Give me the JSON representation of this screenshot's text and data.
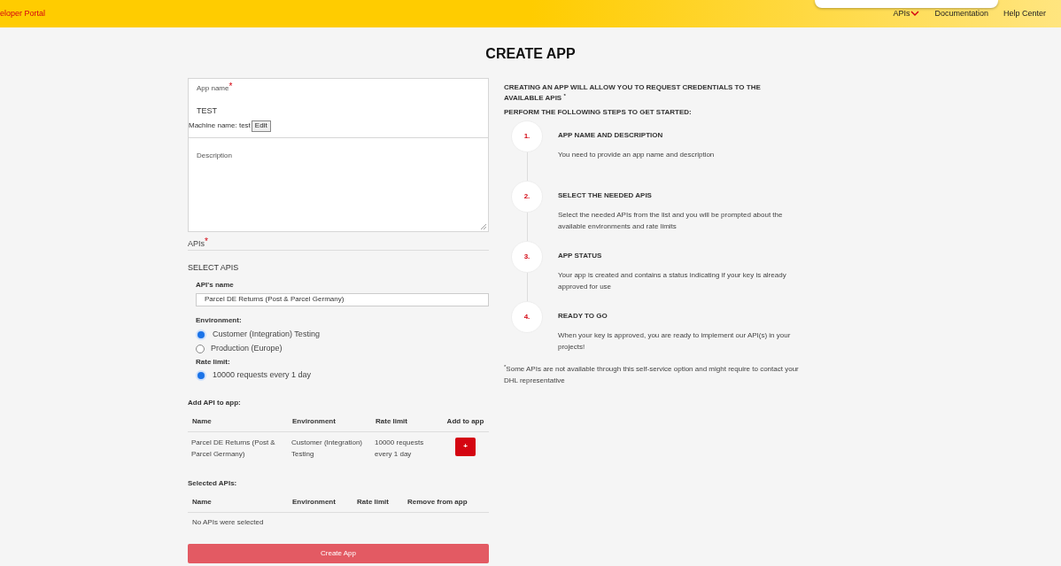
{
  "header": {
    "brand": "eloper Portal",
    "nav": [
      {
        "label": "APIs",
        "kind": "dropdown"
      },
      {
        "label": "Documentation",
        "kind": "link"
      },
      {
        "label": "Help Center",
        "kind": "link"
      }
    ]
  },
  "title": "CREATE APP",
  "form": {
    "app_name": {
      "label": "App name",
      "required_mark": "*",
      "value": "TEST"
    },
    "machine_name": {
      "label": "Machine name: test",
      "button": "Edit"
    },
    "description": {
      "label": "Description"
    },
    "apis": {
      "label": "APIs",
      "required_mark": "*"
    },
    "select_heading": "SELECT APIS",
    "api_name": {
      "label": "API's name",
      "value": "Parcel DE Returns (Post & Parcel Germany)"
    },
    "environment": {
      "label": "Environment:",
      "options": [
        {
          "label": "Customer (Integration) Testing",
          "selected": true
        },
        {
          "label": "Production (Europe)",
          "selected": false
        }
      ]
    },
    "rate_limit": {
      "label": "Rate limit:",
      "options": [
        {
          "label": "10000 requests every 1 day",
          "selected": true
        }
      ]
    },
    "add_table": {
      "title": "Add API to app:",
      "columns": [
        "Name",
        "Environment",
        "Rate limit",
        "Add to app"
      ],
      "rows": [
        {
          "name": "Parcel DE Returns (Post & Parcel Germany)",
          "environment": "Customer (Integration) Testing",
          "rate_limit": "10000 requests every 1 day",
          "button": "+"
        }
      ]
    },
    "selected_table": {
      "title": "Selected APIs:",
      "columns": [
        "Name",
        "Environment",
        "Rate limit",
        "Remove from app"
      ],
      "empty": "No APIs were selected"
    },
    "submit": "Create App"
  },
  "info": {
    "intro": "CREATING AN APP WILL ALLOW YOU TO REQUEST CREDENTIALS TO THE AVAILABLE APIS $^{*}$",
    "steps_heading": "PERFORM THE FOLLOWING STEPS TO GET STARTED:",
    "steps": [
      {
        "number": "1.",
        "title": "APP NAME AND DESCRIPTION",
        "text": "You need to provide an app name and description"
      },
      {
        "number": "2.",
        "title": "SELECT THE NEEDED APIS",
        "text": "Select the needed APIs from the list and you will be prompted about the available environments and rate limits"
      },
      {
        "number": "3.",
        "title": "APP STATUS",
        "text": "Your app is created and contains a status indicating if your key is already approved for use"
      },
      {
        "number": "4.",
        "title": "READY TO GO",
        "text": "When your key is approved, you are ready to implement our API(s) in your projects!"
      }
    ],
    "footnote": "$^{*}$Some APIs are not available through this self-service option and might require to contact your DHL representative"
  }
}
